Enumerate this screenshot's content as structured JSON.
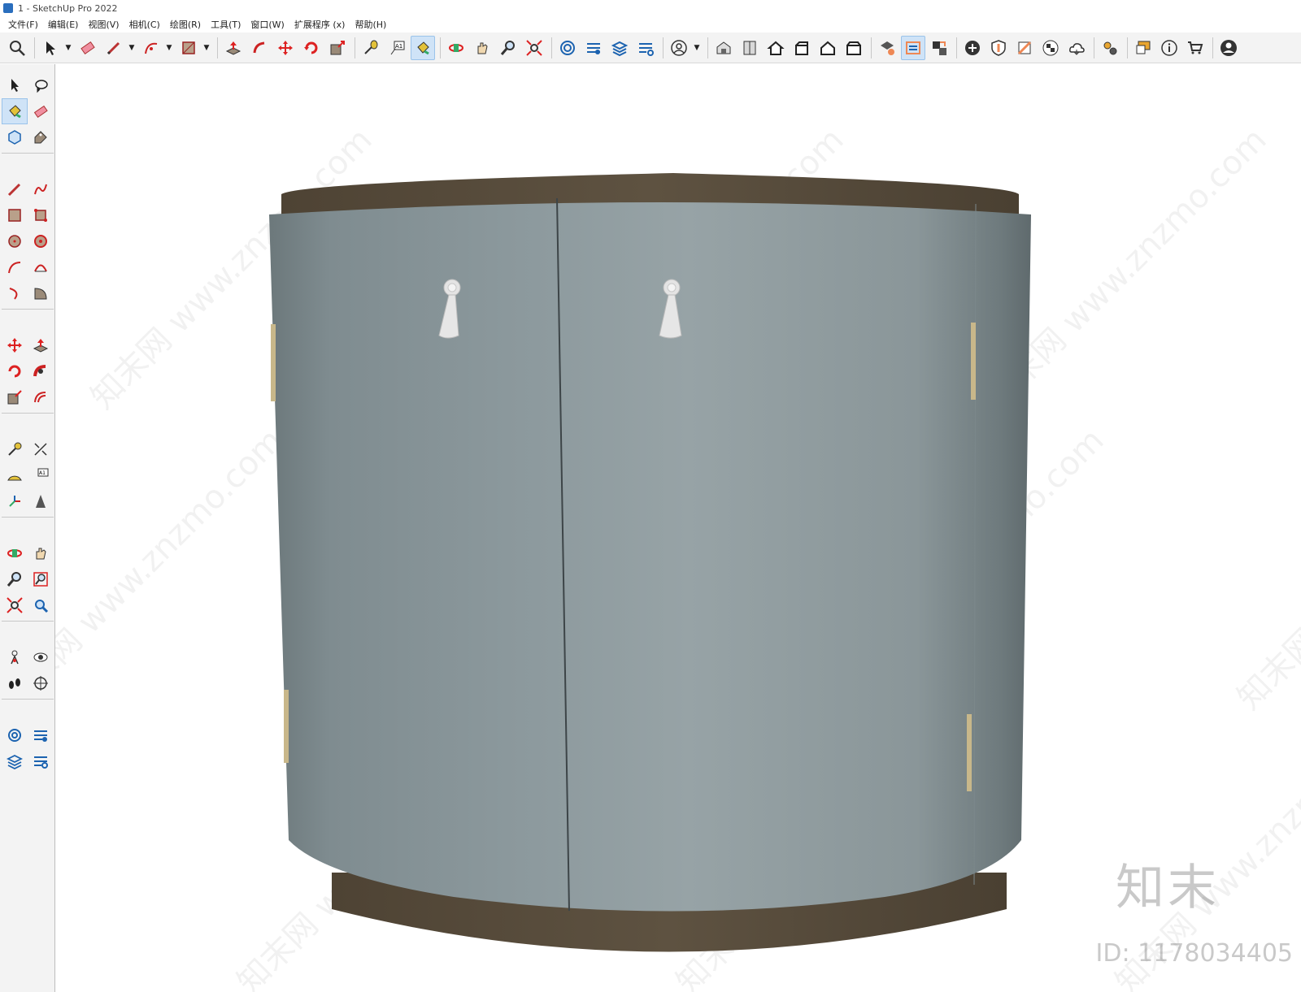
{
  "window": {
    "title": "1 - SketchUp Pro 2022"
  },
  "menu": [
    "文件(F)",
    "编辑(E)",
    "视图(V)",
    "相机(C)",
    "绘图(R)",
    "工具(T)",
    "窗口(W)",
    "扩展程序 (x)",
    "帮助(H)"
  ],
  "toolbar": {
    "icons": [
      "search-icon",
      "select-icon",
      "eraser-icon",
      "pencil-icon",
      "arc-icon",
      "rectangle-icon",
      "push-pull-icon",
      "follow-me-icon",
      "move-icon",
      "rotate-icon",
      "scale-icon",
      "tape-measure-icon",
      "text-icon",
      "paint-bucket-icon",
      "orbit-icon",
      "pan-icon",
      "zoom-icon",
      "zoom-extents-icon",
      "layout-icon",
      "style-builder-icon",
      "tags-icon",
      "scenes-icon",
      "account-icon",
      "warehouse-icon",
      "components-icon",
      "home-icon",
      "materials-icon",
      "house-icon",
      "building-icon",
      "model-info-icon",
      "outliner-icon",
      "entity-info-icon",
      "add-icon",
      "shield-icon",
      "solar-icon",
      "checker-icon",
      "cloud-icon",
      "extensions-icon",
      "instructor-icon",
      "info-icon",
      "cart-icon",
      "user-icon"
    ]
  },
  "watermarks": {
    "site": "知末网 www.znzmo.com",
    "logo": "知末",
    "id_text": "ID: 1178034405"
  },
  "model": {
    "type": "curved two-door cabinet",
    "body_color": "#8f9ea3",
    "top_color": "#5f5242",
    "base_color": "#5a4d3c",
    "handle_color": "#e4e4e4",
    "hinge_color": "#c8b78a"
  }
}
